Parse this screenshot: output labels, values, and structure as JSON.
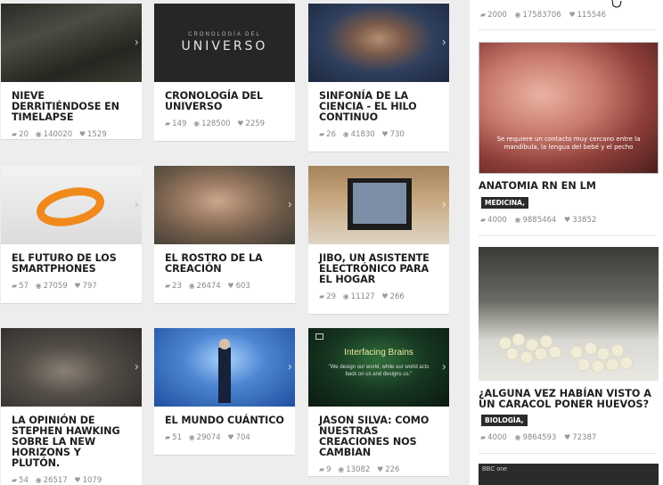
{
  "cards": [
    {
      "title": "NIEVE DERRITIÉNDOSE EN TIMELAPSE",
      "comments": "20",
      "views": "140020",
      "likes": "1529"
    },
    {
      "title": "CRONOLOGÍA DEL UNIVERSO",
      "comments": "149",
      "views": "128500",
      "likes": "2259",
      "thumb_small": "CRONOLOGÍA DEL",
      "thumb_big": "UNIVERSO"
    },
    {
      "title": "SINFONÍA DE LA CIENCIA - EL HILO CONTINUO",
      "comments": "26",
      "views": "41830",
      "likes": "730"
    },
    {
      "title": "EL FUTURO DE LOS SMARTPHONES",
      "comments": "57",
      "views": "27059",
      "likes": "797"
    },
    {
      "title": "EL ROSTRO DE LA CREACIÓN",
      "comments": "23",
      "views": "26474",
      "likes": "603"
    },
    {
      "title": "JIBO, UN ASISTENTE ELECTRÓNICO PARA EL HOGAR",
      "comments": "29",
      "views": "11127",
      "likes": "266"
    },
    {
      "title": "LA OPINIÓN DE STEPHEN HAWKING SOBRE LA NEW HORIZONS Y PLUTÓN.",
      "comments": "54",
      "views": "26517",
      "likes": "1079"
    },
    {
      "title": "EL MUNDO CUÁNTICO",
      "comments": "51",
      "views": "29074",
      "likes": "704"
    },
    {
      "title": "JASON SILVA: COMO NUESTRAS CREACIONES NOS CAMBIAN",
      "comments": "9",
      "views": "13082",
      "likes": "226",
      "thumb_heading": "Interfacing Brains",
      "thumb_quote": "\"We design our world, while our world acts back on us and designs us.\""
    }
  ],
  "sidebar": {
    "top_stats": {
      "comments": "2000",
      "views": "17583706",
      "likes": "115546"
    },
    "items": [
      {
        "title": "ANATOMIA RN EN LM",
        "tag": "MEDICINA,",
        "comments": "4000",
        "views": "9885464",
        "likes": "33852",
        "subtitle": "Se requiere un contacto muy cercano entre la mandíbula, la lengua del bebé y el pecho"
      },
      {
        "title": "¿ALGUNA VEZ HABÍAN VISTO A UN CARACOL PONER HUEVOS?",
        "tag": "BIOLOGÍA,",
        "comments": "4000",
        "views": "9864593",
        "likes": "72387"
      }
    ],
    "bottom_logo": "BBC one"
  },
  "icons": {
    "comment": "comment-icon",
    "views": "eye-icon",
    "likes": "heart-icon",
    "next": "chevron-right-icon"
  }
}
